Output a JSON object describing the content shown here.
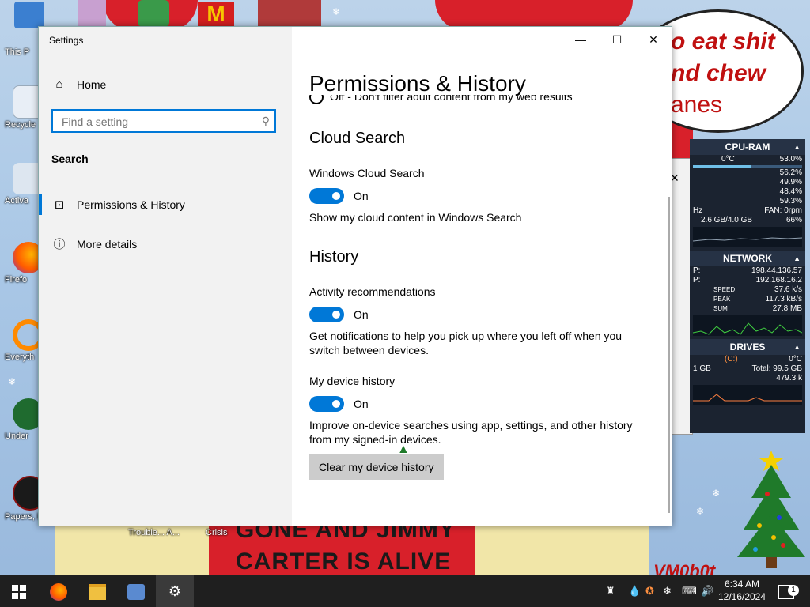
{
  "desktop": {
    "icons": [
      {
        "label": "This P"
      },
      {
        "label": "Recycle"
      },
      {
        "label": "Activa"
      },
      {
        "label": "Firefo"
      },
      {
        "label": "Everyth"
      },
      {
        "label": "Under"
      },
      {
        "label": "Papers, P"
      }
    ],
    "taskbar_labels": [
      "Trouble... A...",
      "Crisis"
    ],
    "wallpaper_text": {
      "speech_1": "o eat shit",
      "speech_2": "nd chew",
      "speech_3": "anes",
      "poster_1": "GONE AND JIMMY",
      "poster_2": "CARTER IS ALIVE",
      "signature": "VM0b0t"
    }
  },
  "widget": {
    "cpu": {
      "title": "CPU-RAM",
      "temp": "0°C",
      "r1": "53.0%",
      "r2": "56.2%",
      "r3": "49.9%",
      "r4": "48.4%",
      "r5": "59.3%",
      "hz": "Hz",
      "fan": "FAN: 0rpm",
      "mem": "2.6 GB/4.0 GB",
      "mem_pct": "66%"
    },
    "network": {
      "title": "NETWORK",
      "ip_label1": "P:",
      "ip1": "198.44.136.57",
      "ip_label2": "P:",
      "ip2": "192.168.16.2",
      "speed_label": "SPEED",
      "speed": "37.6 k/s",
      "peak_label": "PEAK",
      "peak": "117.3 kB/s",
      "sum_label": "SUM",
      "sum": "27.8 MB"
    },
    "drives": {
      "title": "DRIVES",
      "c": "(C:)",
      "c_temp": "0°C",
      "used": "1 GB",
      "total": "Total: 99.5 GB",
      "io": "479.3 k"
    }
  },
  "settings": {
    "window_title": "Settings",
    "home": "Home",
    "search_placeholder": "Find a setting",
    "section": "Search",
    "nav": [
      {
        "label": "Permissions & History"
      },
      {
        "label": "More details"
      }
    ],
    "page_title": "Permissions & History",
    "cut_off_text": "Off - Don't filter adult content from my web results",
    "cloud": {
      "heading": "Cloud Search",
      "label": "Windows Cloud Search",
      "state": "On",
      "desc": "Show my cloud content in Windows Search"
    },
    "history": {
      "heading": "History",
      "activity_label": "Activity recommendations",
      "activity_state": "On",
      "activity_desc": "Get notifications to help you pick up where you left off when you switch between devices.",
      "device_label": "My device history",
      "device_state": "On",
      "device_desc": "Improve on-device searches using app, settings, and other history from my signed-in devices.",
      "clear_button": "Clear my device history"
    }
  },
  "taskbar": {
    "time": "6:34 AM",
    "date": "12/16/2024",
    "notifications": "1"
  }
}
